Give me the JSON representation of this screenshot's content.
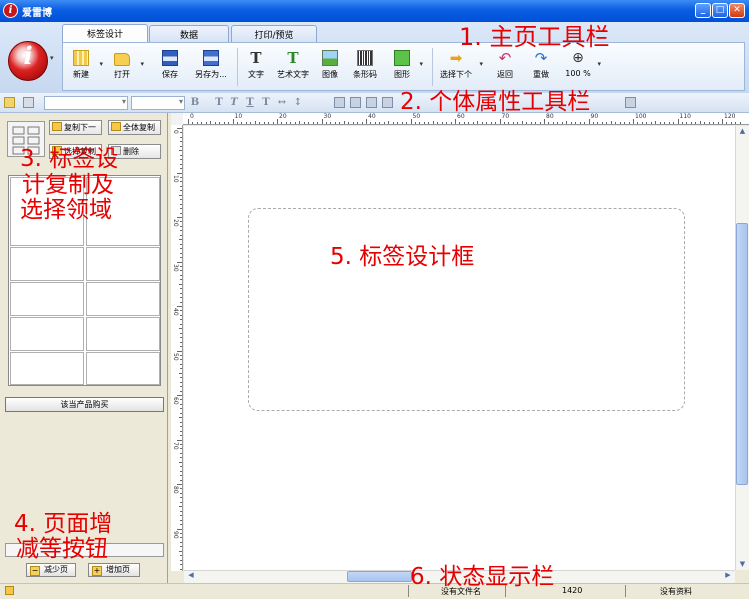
{
  "window": {
    "title": "爱雷博",
    "icon": "app-logo-icon",
    "buttons": [
      "minimize-icon",
      "maximize-icon",
      "close-icon"
    ]
  },
  "ribbon": {
    "orb_letter": "i",
    "tabs": [
      {
        "label": "标签设计",
        "active": true
      },
      {
        "label": "数据",
        "active": false
      },
      {
        "label": "打印/预览",
        "active": false
      }
    ],
    "tools": {
      "new": "新建",
      "open": "打开",
      "save": "保存",
      "save_as": "另存为...",
      "text": "文字",
      "art_text": "艺术文字",
      "image": "图像",
      "barcode": "条形码",
      "shape": "图形",
      "select_next": "选择下个",
      "undo": "返回",
      "redo": "重做",
      "zoom": "100 %"
    }
  },
  "left_panel": {
    "copy_next": "复制下一",
    "copy_all": "全体复制",
    "select_copy": "选择复制",
    "delete": "删除",
    "buy": "该当产品购买",
    "decrease_page": "减少页",
    "increase_page": "增加页"
  },
  "rulers": {
    "top": [
      "0",
      "10",
      "20",
      "30",
      "40",
      "50",
      "60",
      "70",
      "80",
      "90",
      "100",
      "110",
      "120"
    ],
    "left": [
      "0",
      "10",
      "20",
      "30",
      "40",
      "50",
      "60",
      "70",
      "80",
      "90",
      "100"
    ]
  },
  "status": {
    "file": "没有文件名",
    "size": "1420",
    "data": "没有资料"
  },
  "annotations": {
    "a1": "1. 主页工具栏",
    "a2": "2. 个体属性工具栏",
    "a3_l1": "3. 标签设",
    "a3_l2": "计复制及",
    "a3_l3": "选择领域",
    "a4_l1": "4. 页面增",
    "a4_l2": "减等按钮",
    "a5": "5.  标签设计框",
    "a6": "6. 状态显示栏"
  },
  "colors": {
    "annotation": "#e60000",
    "titlebar": "#0a5ee0",
    "ribbon": "#dbe8f8"
  }
}
